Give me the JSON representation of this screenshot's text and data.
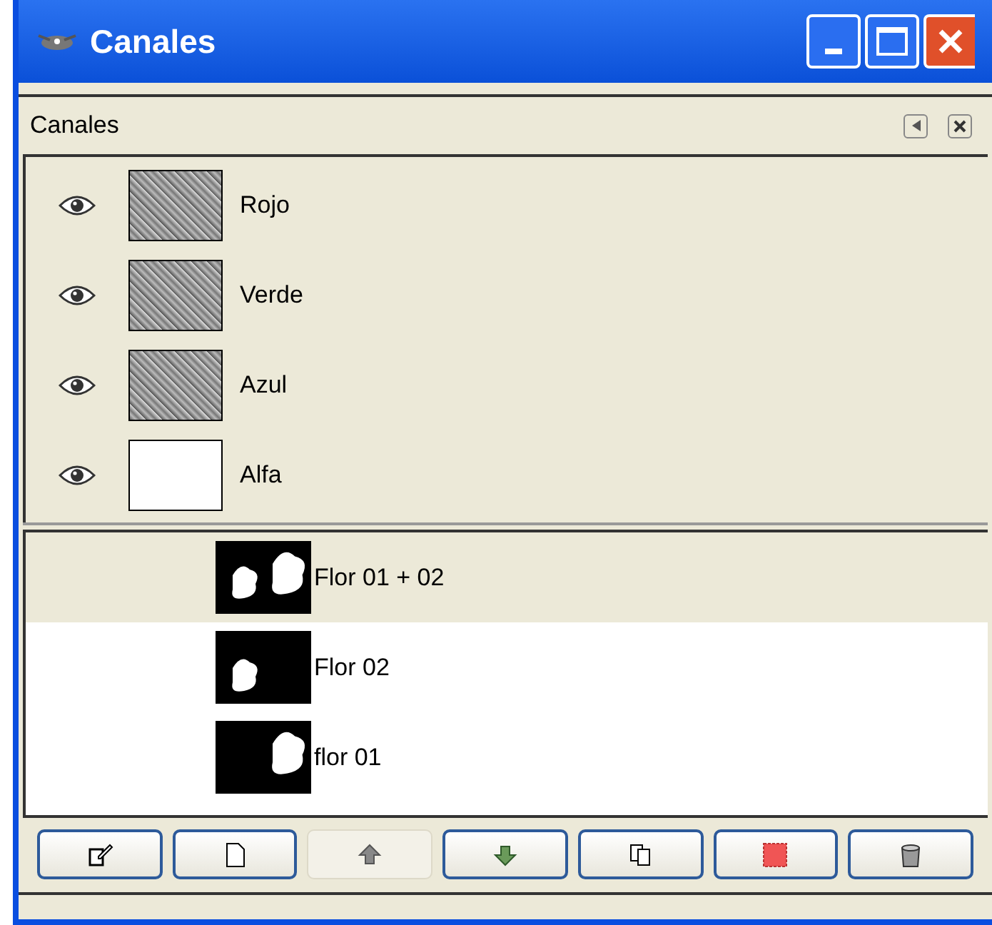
{
  "window": {
    "title": "Canales"
  },
  "panel": {
    "title": "Canales"
  },
  "channels": [
    {
      "name": "Rojo",
      "visible": true,
      "kind": "photo"
    },
    {
      "name": "Verde",
      "visible": true,
      "kind": "photo"
    },
    {
      "name": "Azul",
      "visible": true,
      "kind": "photo"
    },
    {
      "name": "Alfa",
      "visible": true,
      "kind": "blank"
    }
  ],
  "saved_channels": [
    {
      "name": "Flor 01 + 02",
      "selected": true,
      "kind": "both"
    },
    {
      "name": "Flor 02",
      "selected": false,
      "kind": "left"
    },
    {
      "name": "flor 01",
      "selected": false,
      "kind": "right"
    }
  ],
  "buttons": [
    {
      "kind": "edit",
      "disabled": false
    },
    {
      "kind": "new",
      "disabled": false
    },
    {
      "kind": "raise",
      "disabled": true
    },
    {
      "kind": "lower",
      "disabled": false
    },
    {
      "kind": "duplicate",
      "disabled": false
    },
    {
      "kind": "selection",
      "disabled": false
    },
    {
      "kind": "delete",
      "disabled": false
    }
  ]
}
